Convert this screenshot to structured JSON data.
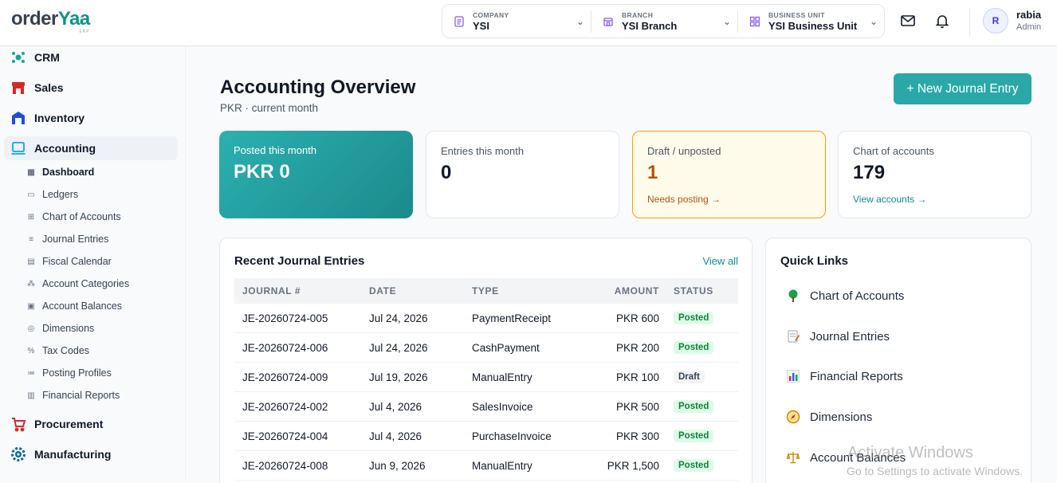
{
  "brand": {
    "part1": "order",
    "part2": "Yaa",
    "tag": "ERP"
  },
  "header": {
    "company": {
      "label": "COMPANY",
      "value": "YSI"
    },
    "branch": {
      "label": "BRANCH",
      "value": "YSI Branch"
    },
    "business_unit": {
      "label": "BUSINESS UNIT",
      "value": "YSI Business Unit"
    },
    "user": {
      "initial": "R",
      "name": "rabia",
      "role": "Admin"
    }
  },
  "sidebar": {
    "modules": [
      {
        "label": "CRM",
        "icon": "crm-icon"
      },
      {
        "label": "Sales",
        "icon": "sales-icon"
      },
      {
        "label": "Inventory",
        "icon": "inventory-icon"
      },
      {
        "label": "Accounting",
        "icon": "accounting-icon"
      },
      {
        "label": "Procurement",
        "icon": "procurement-icon"
      },
      {
        "label": "Manufacturing",
        "icon": "manufacturing-icon"
      }
    ],
    "accounting_items": [
      "Dashboard",
      "Ledgers",
      "Chart of Accounts",
      "Journal Entries",
      "Fiscal Calendar",
      "Account Categories",
      "Account Balances",
      "Dimensions",
      "Tax Codes",
      "Posting Profiles",
      "Financial Reports"
    ]
  },
  "page": {
    "title": "Accounting Overview",
    "subtitle": "PKR · current month",
    "new_button": "+ New Journal Entry"
  },
  "cards": {
    "posted": {
      "title": "Posted this month",
      "value": "PKR 0"
    },
    "entries": {
      "title": "Entries this month",
      "value": "0"
    },
    "draft": {
      "title": "Draft / unposted",
      "value": "1",
      "link": "Needs posting →"
    },
    "chart": {
      "title": "Chart of accounts",
      "value": "179",
      "link": "View accounts →"
    }
  },
  "recent": {
    "title": "Recent Journal Entries",
    "view_all": "View all",
    "columns": [
      "JOURNAL #",
      "DATE",
      "TYPE",
      "AMOUNT",
      "STATUS"
    ],
    "rows": [
      {
        "journal": "JE-20260724-005",
        "date": "Jul 24, 2026",
        "type": "PaymentReceipt",
        "amount": "PKR 600",
        "status": "Posted"
      },
      {
        "journal": "JE-20260724-006",
        "date": "Jul 24, 2026",
        "type": "CashPayment",
        "amount": "PKR 200",
        "status": "Posted"
      },
      {
        "journal": "JE-20260724-009",
        "date": "Jul 19, 2026",
        "type": "ManualEntry",
        "amount": "PKR 100",
        "status": "Draft"
      },
      {
        "journal": "JE-20260724-002",
        "date": "Jul 4, 2026",
        "type": "SalesInvoice",
        "amount": "PKR 500",
        "status": "Posted"
      },
      {
        "journal": "JE-20260724-004",
        "date": "Jul 4, 2026",
        "type": "PurchaseInvoice",
        "amount": "PKR 300",
        "status": "Posted"
      },
      {
        "journal": "JE-20260724-008",
        "date": "Jun 9, 2026",
        "type": "ManualEntry",
        "amount": "PKR 1,500",
        "status": "Posted"
      }
    ]
  },
  "quick_links": {
    "title": "Quick Links",
    "items": [
      {
        "label": "Chart of Accounts",
        "icon": "tree-icon"
      },
      {
        "label": "Journal Entries",
        "icon": "memo-icon"
      },
      {
        "label": "Financial Reports",
        "icon": "bar-chart-icon"
      },
      {
        "label": "Dimensions",
        "icon": "compass-icon"
      },
      {
        "label": "Account Balances",
        "icon": "scales-icon"
      }
    ]
  },
  "watermark": {
    "line1": "Activate Windows",
    "line2": "Go to Settings to activate Windows."
  },
  "colors": {
    "accent": "#2aa8a8",
    "draft": "#b45309",
    "posted": "#15803d"
  }
}
